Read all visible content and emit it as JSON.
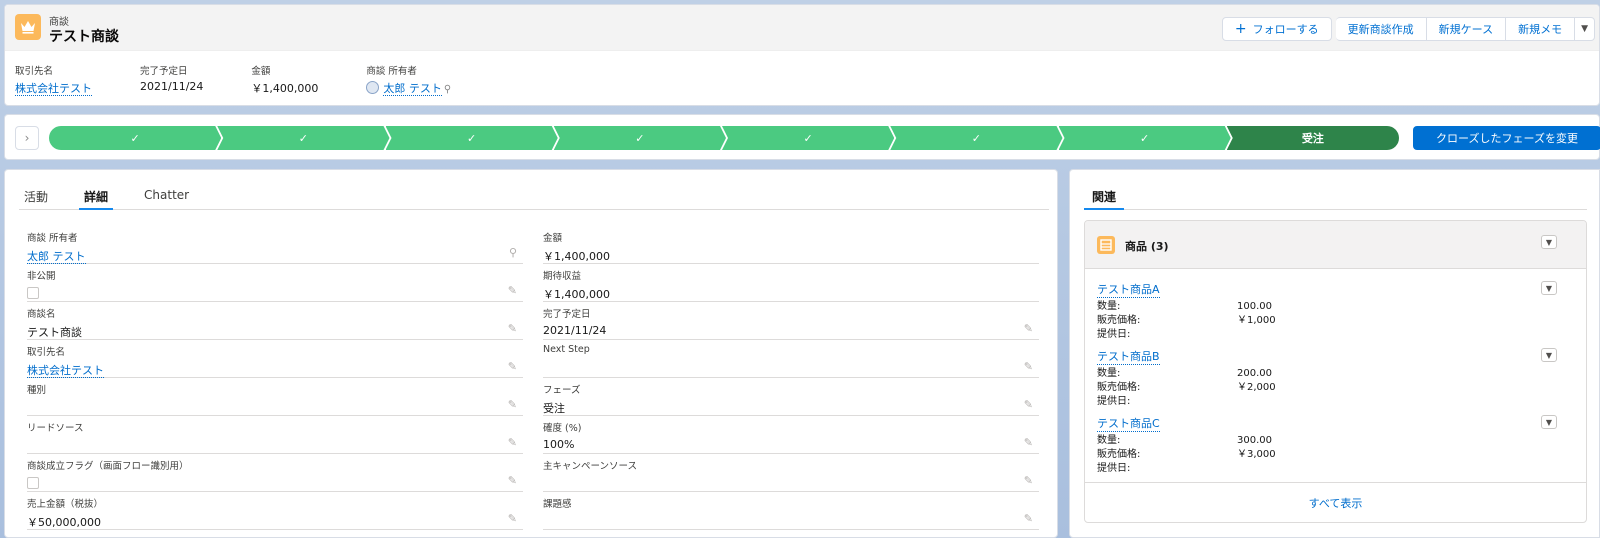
{
  "header": {
    "object_label": "商談",
    "record_title": "テスト商談",
    "buttons": {
      "follow": "フォローする",
      "renew": "更新商談作成",
      "new_case": "新規ケース",
      "new_note": "新規メモ"
    },
    "highlights": [
      {
        "label": "取引先名",
        "value": "株式会社テスト"
      },
      {
        "label": "完了予定日",
        "value": "2021/11/24"
      },
      {
        "label": "金額",
        "value": "￥1,400,000"
      },
      {
        "label": "商談 所有者",
        "value": "太郎 テスト"
      }
    ]
  },
  "path": {
    "completed_mark": "✓",
    "current_stage": "受注",
    "change_button": "クローズしたフェーズを変更"
  },
  "details": {
    "tabs": [
      "活動",
      "詳細",
      "Chatter"
    ],
    "left": [
      {
        "label": "商談 所有者",
        "value": "太郎 テスト"
      },
      {
        "label": "非公開",
        "value": ""
      },
      {
        "label": "商談名",
        "value": "テスト商談"
      },
      {
        "label": "取引先名",
        "value": "株式会社テスト"
      },
      {
        "label": "種別",
        "value": ""
      },
      {
        "label": "リードソース",
        "value": ""
      },
      {
        "label": "商談成立フラグ（画面フロー識別用）",
        "value": ""
      },
      {
        "label": "売上金額（税抜）",
        "value": "￥50,000,000"
      }
    ],
    "right": [
      {
        "label": "金額",
        "value": "￥1,400,000"
      },
      {
        "label": "期待収益",
        "value": "￥1,400,000"
      },
      {
        "label": "完了予定日",
        "value": "2021/11/24"
      },
      {
        "label": "Next Step",
        "value": ""
      },
      {
        "label": "フェーズ",
        "value": "受注"
      },
      {
        "label": "確度 (%)",
        "value": "100%"
      },
      {
        "label": "主キャンペーンソース",
        "value": ""
      },
      {
        "label": "課題感",
        "value": ""
      }
    ]
  },
  "related": {
    "tab": "関連",
    "products_title": "商品 (3)",
    "field_labels": {
      "qty": "数量:",
      "price": "販売価格:",
      "date": "提供日:"
    },
    "products": [
      {
        "name": "テスト商品A",
        "qty": "100.00",
        "price": "￥1,000",
        "date": ""
      },
      {
        "name": "テスト商品B",
        "qty": "200.00",
        "price": "￥2,000",
        "date": ""
      },
      {
        "name": "テスト商品C",
        "qty": "300.00",
        "price": "￥3,000",
        "date": ""
      }
    ],
    "view_all": "すべて表示"
  },
  "colors": {
    "path_complete": "#4bca81",
    "path_current": "#2e844a",
    "brand_button": "#0070d2",
    "link": "#006dcc",
    "opportunity_icon": "#fcb95b"
  }
}
